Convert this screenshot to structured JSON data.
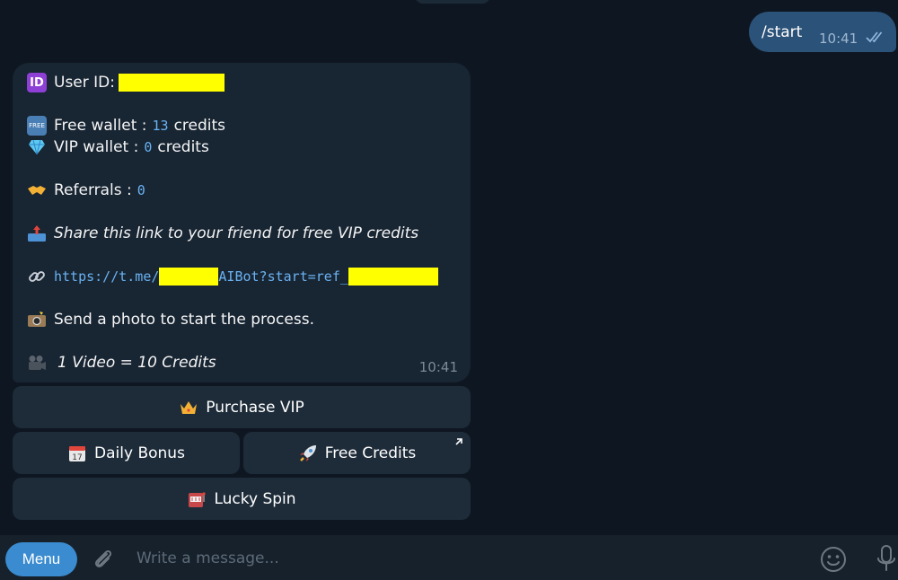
{
  "outgoing": {
    "text": "/start",
    "time": "10:41"
  },
  "bot_message": {
    "user_id_label": "User ID:",
    "free_wallet_label": "Free wallet :",
    "free_wallet_value": "13",
    "free_wallet_unit": "credits",
    "vip_wallet_label": "VIP wallet :",
    "vip_wallet_value": "0",
    "vip_wallet_unit": "credits",
    "referrals_label": "Referrals :",
    "referrals_value": "0",
    "share_text": "Share this link to your friend for free VIP credits",
    "link_prefix": "https://t.me/",
    "link_middle": "AIBot?start=ref_",
    "send_photo_text": "Send a photo to start the process.",
    "video_text": "1 Video = 10 Credits",
    "time": "10:41",
    "icons": {
      "id": "id-badge-icon",
      "free": "free-badge-icon",
      "vip": "gem-icon",
      "referrals": "handshake-icon",
      "share": "outbox-tray-icon",
      "link": "link-icon",
      "photo": "camera-flash-icon",
      "video": "video-camera-icon"
    }
  },
  "keyboard": {
    "purchase_vip": "Purchase VIP",
    "daily_bonus": "Daily Bonus",
    "free_credits": "Free Credits",
    "lucky_spin": "Lucky Spin"
  },
  "input_bar": {
    "menu_label": "Menu",
    "placeholder": "Write a message..."
  },
  "colors": {
    "background": "#0e1621",
    "outgoing_bubble": "#2b5278",
    "incoming_bubble": "#182533",
    "link": "#6ab2f2",
    "menu_button": "#3a8bcf",
    "redaction": "#ffff00"
  }
}
